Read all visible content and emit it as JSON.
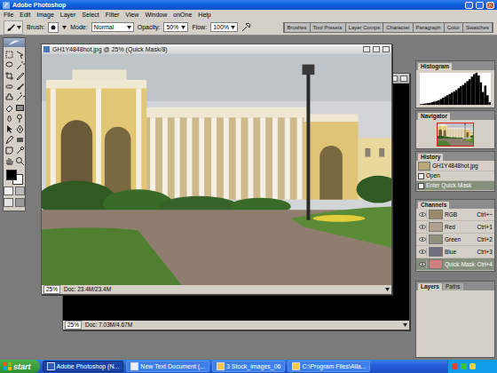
{
  "app": {
    "title": "Adobe Photoshop"
  },
  "menu": [
    "File",
    "Edit",
    "Image",
    "Layer",
    "Select",
    "Filter",
    "View",
    "Window",
    "onOne",
    "Help"
  ],
  "options": {
    "brush_label": "Brush:",
    "mode_label": "Mode:",
    "mode": "Normal",
    "opacity_label": "Opacity:",
    "opacity": "50%",
    "flow_label": "Flow:",
    "flow": "100%"
  },
  "palette_well": [
    {
      "label": "Brushes"
    },
    {
      "label": "Tool Presets"
    },
    {
      "label": "Layer Comps"
    },
    {
      "label": "Character"
    },
    {
      "label": "Paragraph"
    },
    {
      "label": "Color"
    },
    {
      "label": "Swatches"
    }
  ],
  "swatches": {
    "foreground": "#000000",
    "background": "#ffffff"
  },
  "documents": [
    {
      "title": "GH1Y4848hot.jpg @ 25% (Quick Mask/8)",
      "zoom": "25%",
      "doc": "Doc: 23.4M/23.4M",
      "active": true
    },
    {
      "zoom": "25%",
      "doc": "Doc: 7.03M/4.67M",
      "active": false
    }
  ],
  "panels": {
    "histogram": {
      "tabs": [
        {
          "label": "Histogram",
          "selected": true
        }
      ],
      "values": [
        2,
        3,
        4,
        5,
        6,
        8,
        10,
        12,
        14,
        18,
        22,
        26,
        30,
        34,
        38,
        42,
        46,
        52,
        58,
        62,
        68,
        74,
        80,
        88,
        96,
        100,
        92,
        70,
        40,
        60,
        30,
        8
      ]
    },
    "navigator": {
      "tabs": [
        {
          "label": "Navigator",
          "selected": true
        }
      ]
    },
    "history": {
      "tabs": [
        {
          "label": "History",
          "selected": true
        }
      ],
      "source": "GH1Y4848hot.jpg",
      "steps": [
        {
          "label": "Open",
          "selected": false
        },
        {
          "label": "Enter Quick Mask",
          "selected": true
        }
      ]
    },
    "channels": {
      "tabs": [
        {
          "label": "Channels",
          "selected": true
        }
      ],
      "rows": [
        {
          "name": "RGB",
          "shortcut": "Ctrl+~",
          "visible": true,
          "selected": false
        },
        {
          "name": "Red",
          "shortcut": "Ctrl+1",
          "visible": true,
          "selected": false
        },
        {
          "name": "Green",
          "shortcut": "Ctrl+2",
          "visible": true,
          "selected": false
        },
        {
          "name": "Blue",
          "shortcut": "Ctrl+3",
          "visible": true,
          "selected": false
        },
        {
          "name": "Quick Mask",
          "shortcut": "Ctrl+4",
          "visible": true,
          "selected": true
        }
      ]
    },
    "layers": {
      "tabs": [
        {
          "label": "Layers",
          "selected": true
        },
        {
          "label": "Paths",
          "selected": false
        }
      ]
    }
  },
  "taskbar": {
    "start": "start",
    "items": [
      {
        "label": "Adobe Photoshop (N...",
        "selected": true
      },
      {
        "label": "New Text Document (...",
        "selected": false
      },
      {
        "label": "3 Stock_images_06",
        "selected": false
      },
      {
        "label": "C:\\Program Files\\Alla...",
        "selected": false
      }
    ]
  }
}
